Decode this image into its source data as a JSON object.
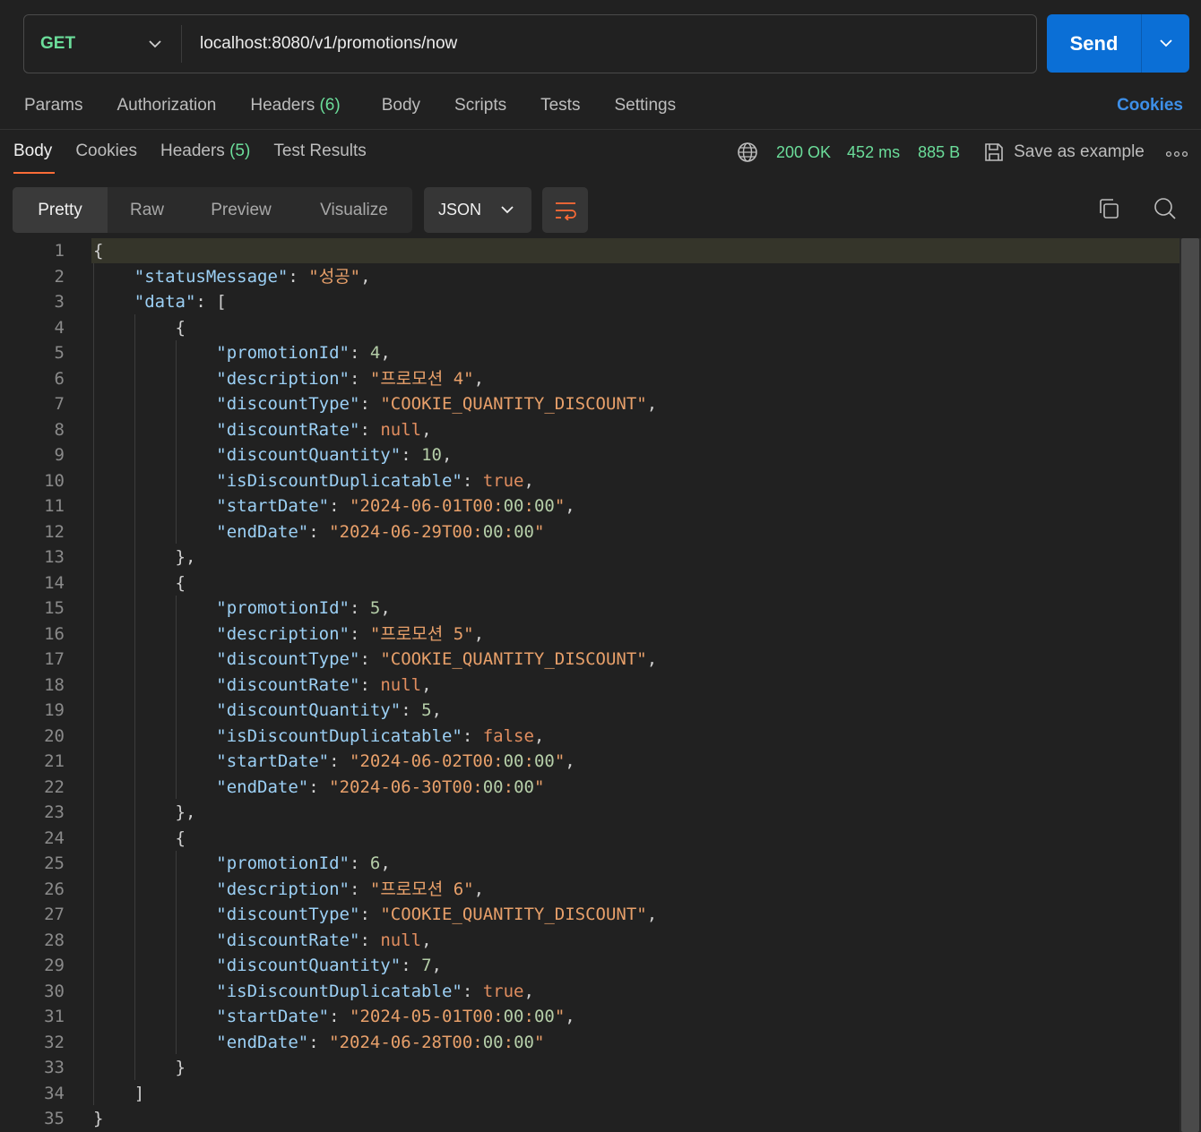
{
  "request": {
    "method": "GET",
    "url": "localhost:8080/v1/promotions/now",
    "send_label": "Send",
    "tabs": [
      {
        "label": "Params"
      },
      {
        "label": "Authorization"
      },
      {
        "label": "Headers",
        "count": "(6)"
      },
      {
        "label": "Body"
      },
      {
        "label": "Scripts"
      },
      {
        "label": "Tests"
      },
      {
        "label": "Settings"
      }
    ],
    "cookies_label": "Cookies"
  },
  "response": {
    "tabs": [
      {
        "label": "Body"
      },
      {
        "label": "Cookies"
      },
      {
        "label": "Headers",
        "count": "(5)"
      },
      {
        "label": "Test Results"
      }
    ],
    "status": "200 OK",
    "time": "452 ms",
    "size": "885 B",
    "save_label": "Save as example",
    "view_modes": [
      "Pretty",
      "Raw",
      "Preview",
      "Visualize"
    ],
    "format": "JSON"
  },
  "colors": {
    "accent_blue": "#0b6fd6",
    "status_green": "#6bdd9a",
    "tab_underline": "#ff6c37"
  },
  "code_lines": [
    "{",
    "    \"statusMessage\": \"성공\",",
    "    \"data\": [",
    "        {",
    "            \"promotionId\": 4,",
    "            \"description\": \"프로모션 4\",",
    "            \"discountType\": \"COOKIE_QUANTITY_DISCOUNT\",",
    "            \"discountRate\": null,",
    "            \"discountQuantity\": 10,",
    "            \"isDiscountDuplicatable\": true,",
    "            \"startDate\": \"2024-06-01T00:00:00\",",
    "            \"endDate\": \"2024-06-29T00:00:00\"",
    "        },",
    "        {",
    "            \"promotionId\": 5,",
    "            \"description\": \"프로모션 5\",",
    "            \"discountType\": \"COOKIE_QUANTITY_DISCOUNT\",",
    "            \"discountRate\": null,",
    "            \"discountQuantity\": 5,",
    "            \"isDiscountDuplicatable\": false,",
    "            \"startDate\": \"2024-06-02T00:00:00\",",
    "            \"endDate\": \"2024-06-30T00:00:00\"",
    "        },",
    "        {",
    "            \"promotionId\": 6,",
    "            \"description\": \"프로모션 6\",",
    "            \"discountType\": \"COOKIE_QUANTITY_DISCOUNT\",",
    "            \"discountRate\": null,",
    "            \"discountQuantity\": 7,",
    "            \"isDiscountDuplicatable\": true,",
    "            \"startDate\": \"2024-05-01T00:00:00\",",
    "            \"endDate\": \"2024-06-28T00:00:00\"",
    "        }",
    "    ]",
    "}"
  ]
}
